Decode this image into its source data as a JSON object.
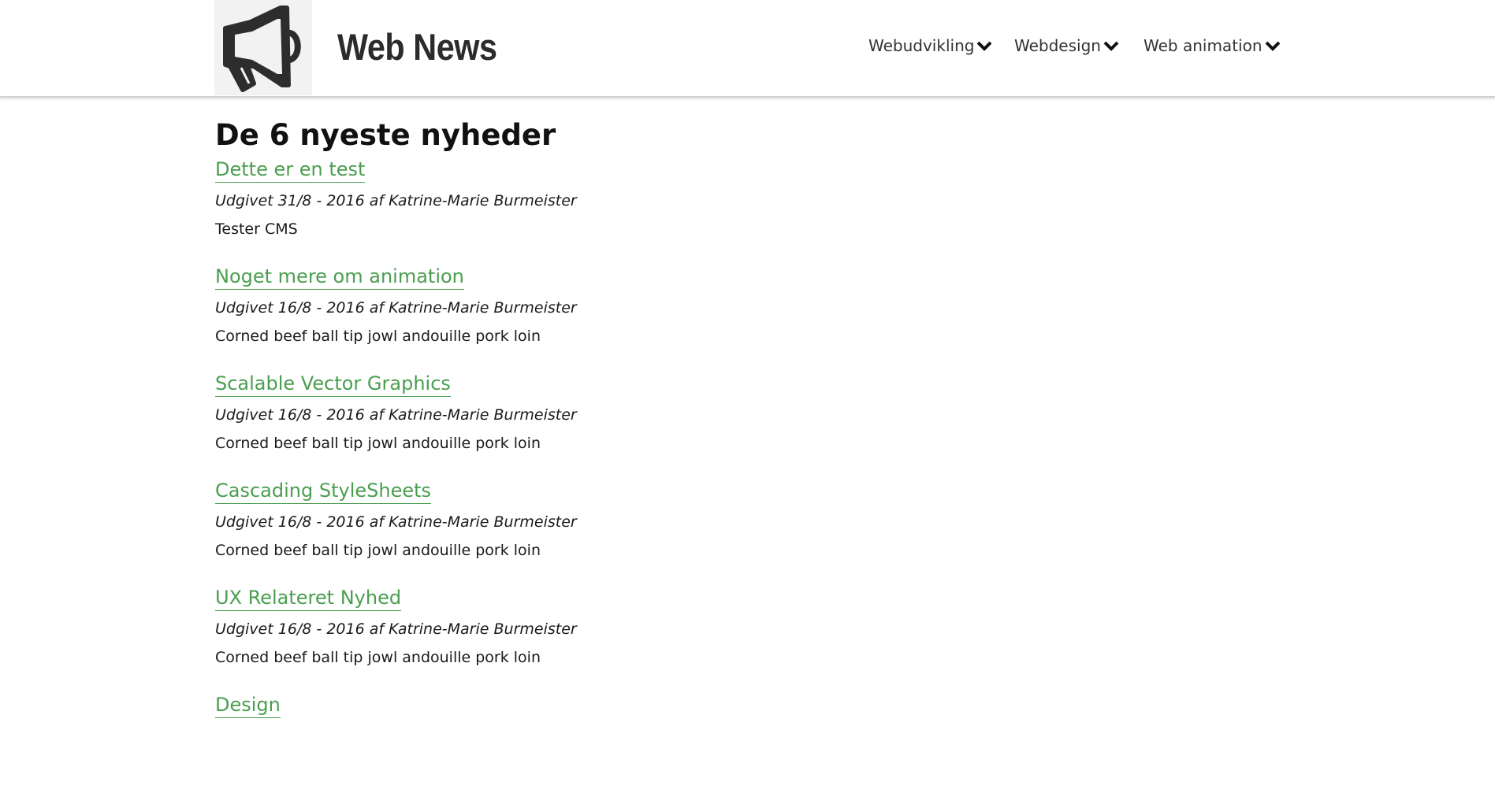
{
  "header": {
    "logo_icon": "megaphone-icon",
    "site_title": "Web News",
    "nav": [
      {
        "label": "Webudvikling",
        "icon": "chevron-down-icon"
      },
      {
        "label": "Webdesign",
        "icon": "chevron-down-icon"
      },
      {
        "label": "Web animation",
        "icon": "chevron-down-icon"
      }
    ]
  },
  "main": {
    "heading": "De 6 nyeste nyheder",
    "articles": [
      {
        "title": "Dette er en test",
        "meta": "Udgivet 31/8 - 2016 af Katrine-Marie Burmeister",
        "excerpt": "Tester CMS"
      },
      {
        "title": "Noget mere om animation",
        "meta": "Udgivet 16/8 - 2016 af Katrine-Marie Burmeister",
        "excerpt": "Corned beef ball tip jowl andouille pork loin"
      },
      {
        "title": "Scalable Vector Graphics",
        "meta": "Udgivet 16/8 - 2016 af Katrine-Marie Burmeister",
        "excerpt": "Corned beef ball tip jowl andouille pork loin"
      },
      {
        "title": "Cascading StyleSheets",
        "meta": "Udgivet 16/8 - 2016 af Katrine-Marie Burmeister",
        "excerpt": "Corned beef ball tip jowl andouille pork loin"
      },
      {
        "title": "UX Relateret Nyhed",
        "meta": "Udgivet 16/8 - 2016 af Katrine-Marie Burmeister",
        "excerpt": "Corned beef ball tip jowl andouille pork loin"
      },
      {
        "title": "Design",
        "meta": "",
        "excerpt": ""
      }
    ]
  },
  "colors": {
    "link_green": "#4a9e4f",
    "text_dark": "#1a1a1a",
    "header_border": "#d2d2d2"
  }
}
